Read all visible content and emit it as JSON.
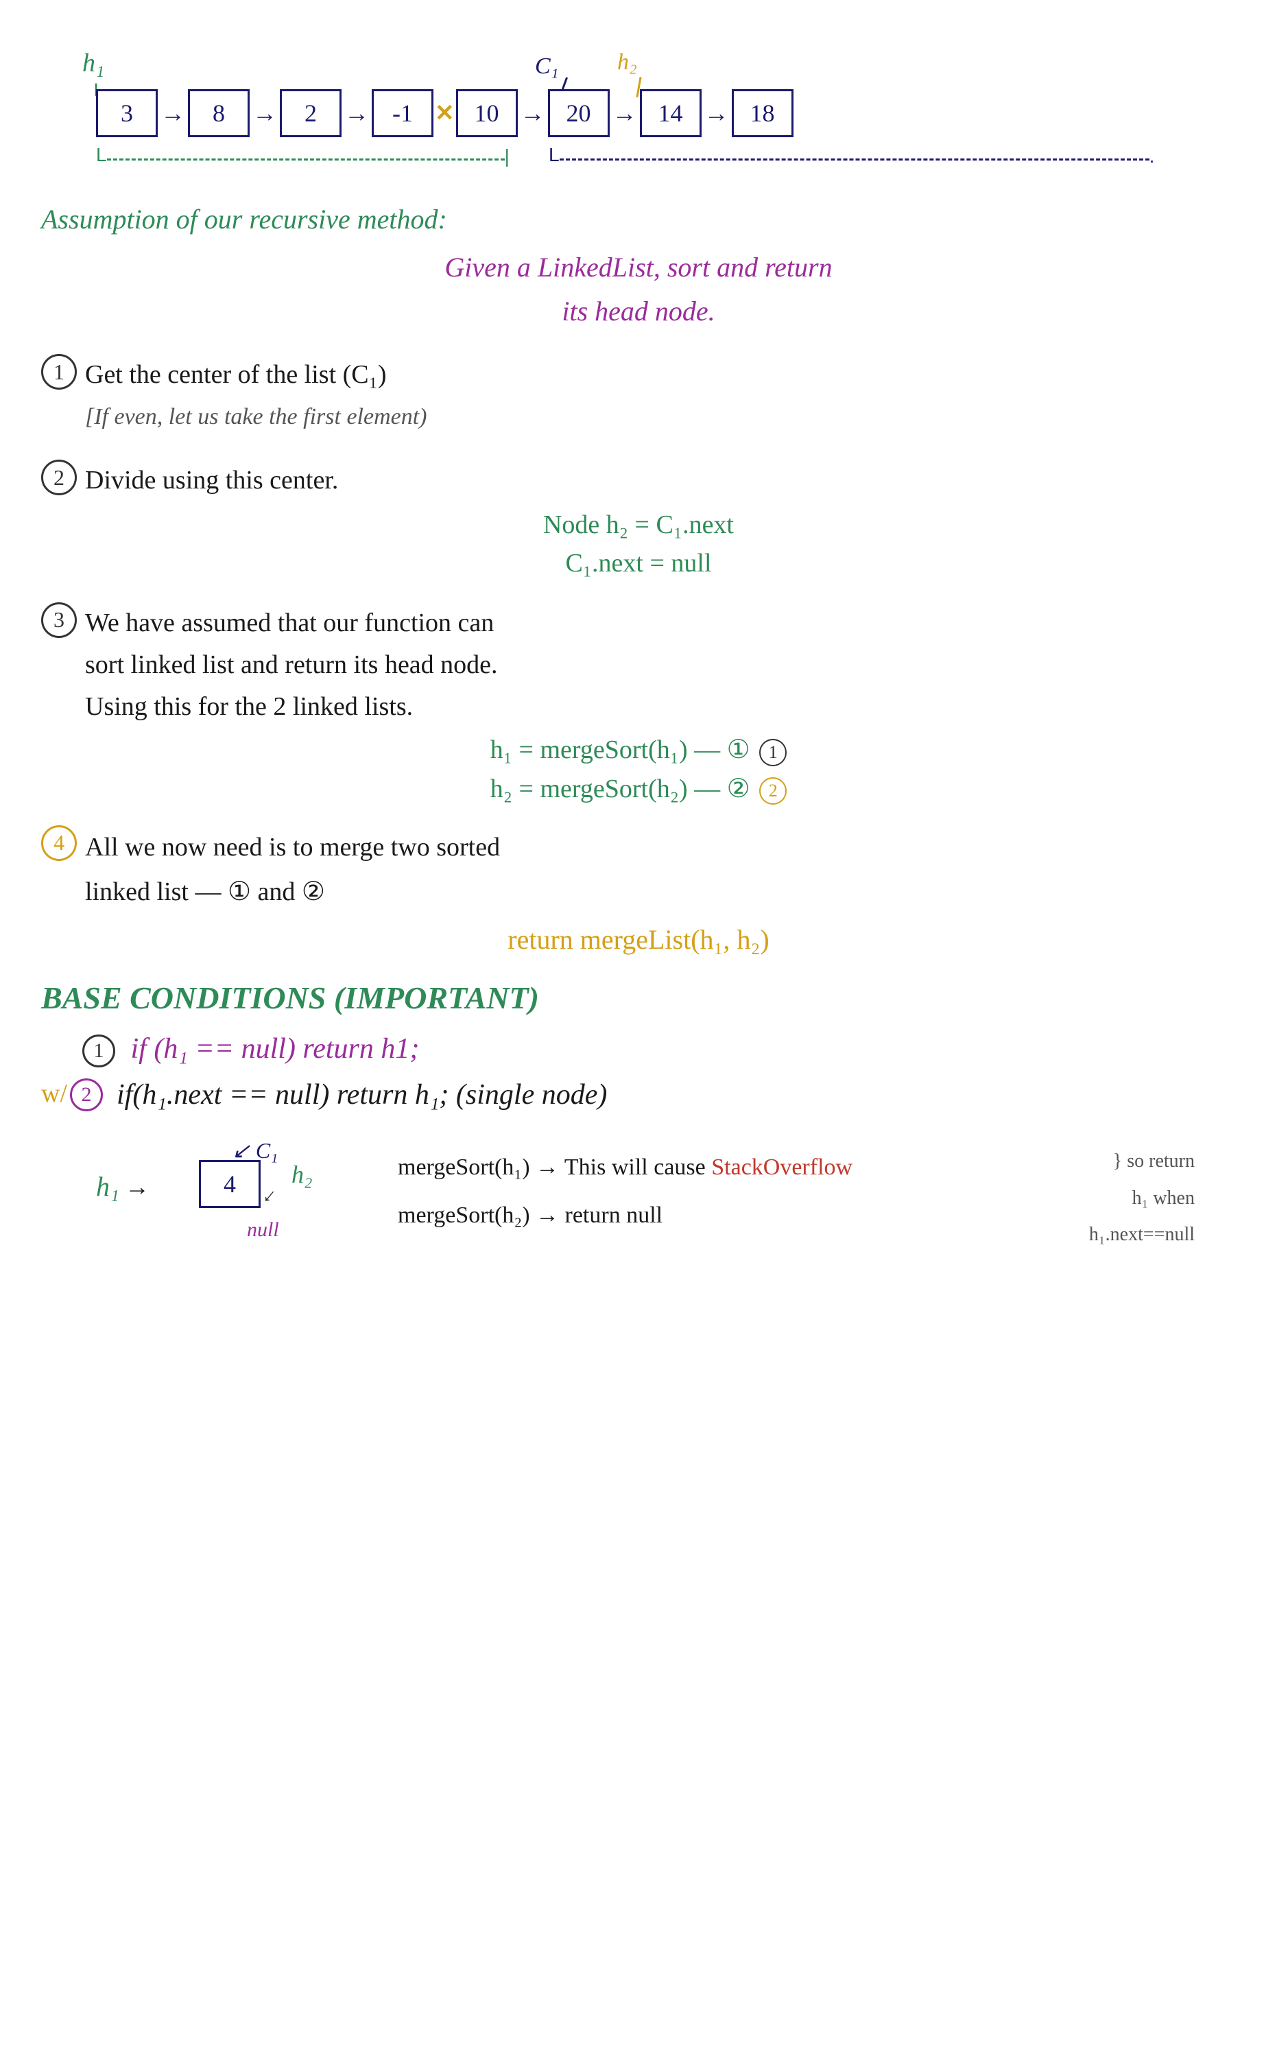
{
  "diagram": {
    "h1_label": "h₁",
    "c1_label": "C₁",
    "h2_label": "h₂",
    "nodes": [
      "3",
      "8",
      "2",
      "-1",
      "10",
      "20",
      "14",
      "18"
    ],
    "cross_symbol": "✕"
  },
  "assumption": {
    "title": "Assumption of our recursive method:",
    "line1": "Given a LinkedList, sort and return",
    "line2": "its head node."
  },
  "step1": {
    "number": "1",
    "text": "Get the center of the list (C₁)",
    "subtext": "[If even, let us take the first element)"
  },
  "step2": {
    "number": "2",
    "text": "Divide using this center.",
    "code1": "Node h₂ = C₁.next",
    "code2": "C₁.next = null"
  },
  "step3": {
    "number": "3",
    "text1": "We have assumed that our function can",
    "text2": "sort linked list and return its head node.",
    "text3": "Using this for the 2 linked lists.",
    "merge1": "h₁ = mergeSort(h₁) — ①",
    "merge2": "h₂ = mergeSort(h₂) — ②"
  },
  "step4": {
    "number": "4",
    "text1": "All we now need is to merge two sorted",
    "text2": "linked list — ① and ②",
    "return_line": "return mergeList(h₁, h₂)"
  },
  "base_conditions": {
    "title": "BASE CONDITIONS (IMPORTANT)",
    "bc1": "if (h₁ == null) return h1;",
    "bc2_prefix": "w/",
    "bc2_num": "2",
    "bc2": "if(h₁.next == null) return h₁; (single node)"
  },
  "bottom_diagram": {
    "h1": "h₁",
    "arrow": "→",
    "node": "4",
    "c1_label": "C₁",
    "null_label": "null",
    "h2_label": "h₂",
    "line1": "mergeSort(h₁) → This will cause",
    "line1b": "StackOverflow",
    "line2": "mergeSort(h₂) → return null",
    "annotation1": "so return",
    "annotation2": "h₁ when",
    "annotation3": "h₁.next==null"
  }
}
